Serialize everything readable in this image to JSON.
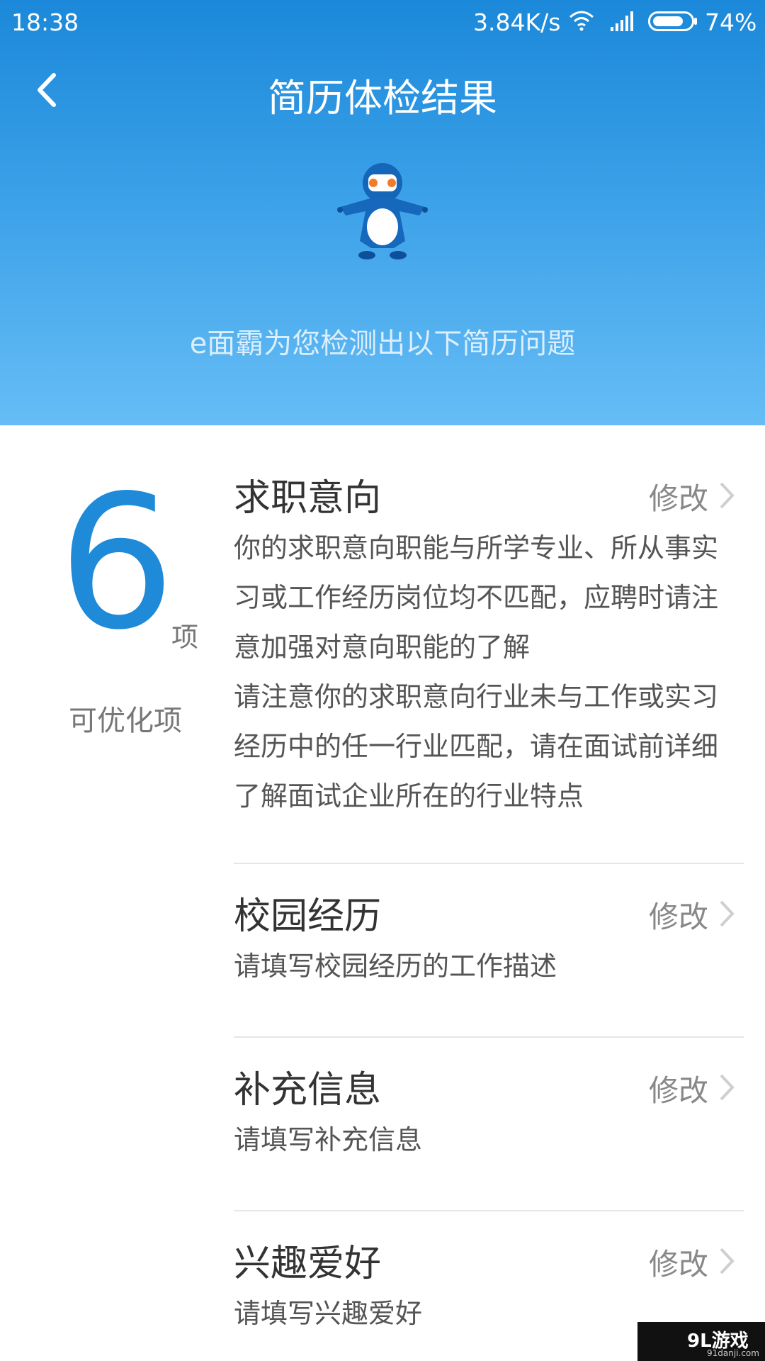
{
  "status_bar": {
    "time": "18:38",
    "network_speed": "3.84K/s",
    "battery_percent": "74%"
  },
  "header": {
    "title": "简历体检结果",
    "subtitle": "e面霸为您检测出以下简历问题"
  },
  "score": {
    "value": "6",
    "unit": "项",
    "caption": "可优化项"
  },
  "items": [
    {
      "title": "求职意向",
      "edit_label": "修改",
      "description": "你的求职意向职能与所学专业、所从事实\n习或工作经历岗位均不匹配，应聘时请注\n意加强对意向职能的了解\n请注意你的求职意向行业未与工作或实习\n经历中的任一行业匹配，请在面试前详细\n了解面试企业所在的行业特点"
    },
    {
      "title": "校园经历",
      "edit_label": "修改",
      "description": "请填写校园经历的工作描述"
    },
    {
      "title": "补充信息",
      "edit_label": "修改",
      "description": "请填写补充信息"
    },
    {
      "title": "兴趣爱好",
      "edit_label": "修改",
      "description": "请填写兴趣爱好"
    }
  ],
  "watermark": {
    "brand": "9L游戏",
    "url": "91danji.com"
  },
  "colors": {
    "header_top": "#1b88d9",
    "header_bottom": "#66bdf5",
    "score": "#1e8ad8"
  }
}
